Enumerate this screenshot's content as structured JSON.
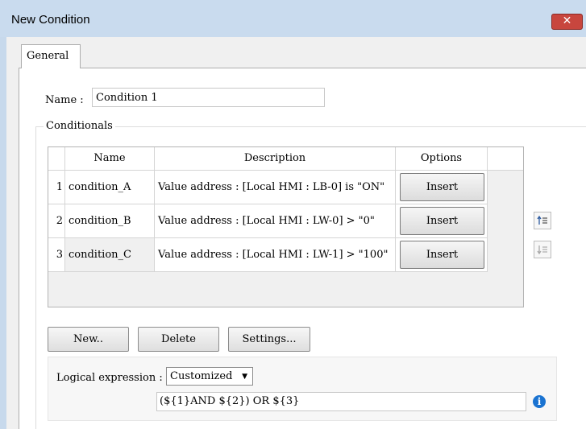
{
  "window": {
    "title": "New Condition",
    "close_glyph": "✕"
  },
  "tabs": [
    {
      "label": "General"
    }
  ],
  "name_field": {
    "label": "Name :",
    "value": "Condition 1"
  },
  "conditionals": {
    "group_title": "Conditionals",
    "columns": [
      "Name",
      "Description",
      "Options"
    ],
    "rows": [
      {
        "num": "1",
        "name": "condition_A",
        "description": "Value address : [Local HMI : LB-0] is \"ON\"",
        "option": "Insert"
      },
      {
        "num": "2",
        "name": "condition_B",
        "description": "Value address : [Local HMI : LW-0] > \"0\"",
        "option": "Insert"
      },
      {
        "num": "3",
        "name": "condition_C",
        "description": "Value address : [Local HMI : LW-1] > \"100\"",
        "option": "Insert"
      }
    ]
  },
  "buttons": {
    "new": "New..",
    "delete": "Delete",
    "settings": "Settings..."
  },
  "side_buttons": {
    "move_up_icon": "move-up-icon",
    "move_down_icon": "move-down-icon"
  },
  "logical": {
    "label": "Logical expression :",
    "select_value": "Customized",
    "expression": "(${1}AND ${2}) OR ${3}"
  },
  "colors": {
    "close_button": "#c8463e",
    "titlebar": "#c9dbee",
    "info_icon": "#1a73d1"
  }
}
